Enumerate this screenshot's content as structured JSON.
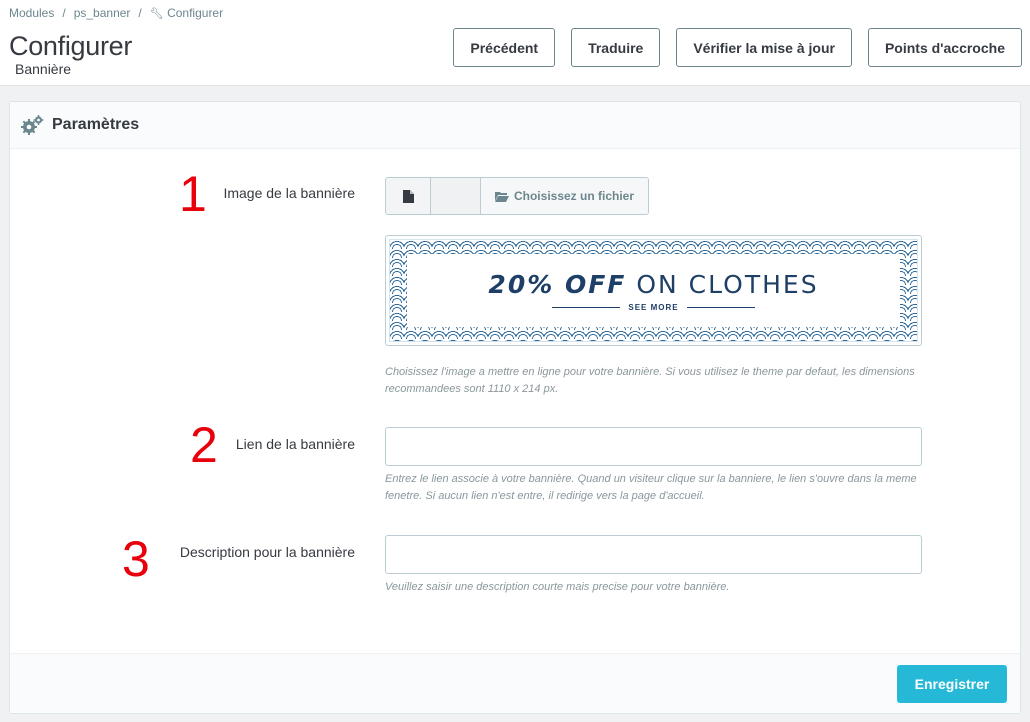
{
  "breadcrumb": {
    "item1": "Modules",
    "item2": "ps_banner",
    "item3": "Configurer",
    "sep": "/"
  },
  "header": {
    "title": "Configurer",
    "subtitle": "Bannière"
  },
  "toolbar": {
    "previous": "Précédent",
    "translate": "Traduire",
    "check_update": "Vérifier la mise à jour",
    "hooks": "Points d'accroche"
  },
  "panel": {
    "heading": "Paramètres",
    "heading_icon": "cogs-icon"
  },
  "form": {
    "image": {
      "marker": "1",
      "label": "Image de la bannière",
      "choose_file": "Choisissez un fichier",
      "help": "Choisissez l'image a mettre en ligne pour votre bannière. Si vous utilisez le theme par defaut, les dimensions recommandees sont 1110 x 214 px.",
      "banner_text_bold": "20% OFF",
      "banner_text": "ON CLOTHES",
      "banner_sub": "SEE MORE"
    },
    "link": {
      "marker": "2",
      "label": "Lien de la bannière",
      "value": "",
      "help": "Entrez le lien associe à votre bannière. Quand un visiteur clique sur la banniere, le lien s'ouvre dans la meme fenetre. Si aucun lien n'est entre, il redirige vers la page d'accueil."
    },
    "description": {
      "marker": "3",
      "label": "Description pour la bannière",
      "value": "",
      "help": "Veuillez saisir une description courte mais precise pour votre bannière."
    }
  },
  "footer": {
    "save": "Enregistrer"
  },
  "colors": {
    "accent": "#25b9d7",
    "marker": "#e8000b",
    "banner_blue": "#1e3f66"
  }
}
